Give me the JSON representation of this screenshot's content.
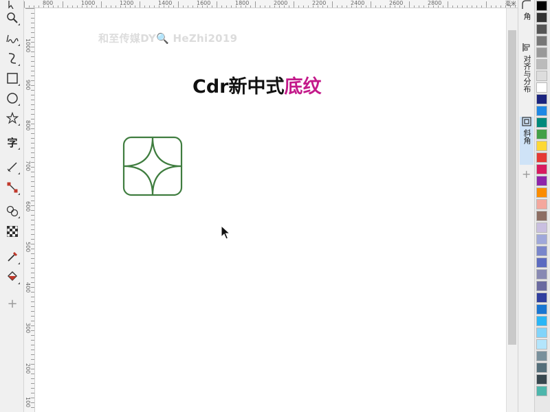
{
  "ruler_top": {
    "labels": [
      "800",
      "1000",
      "1200",
      "1400",
      "1600",
      "1800",
      "2000",
      "2200",
      "2400",
      "2600",
      "2800"
    ],
    "unit": "毫米"
  },
  "ruler_left": {
    "labels": [
      "1000",
      "900",
      "800",
      "700",
      "600",
      "500",
      "400",
      "300",
      "200",
      "100"
    ]
  },
  "toolbox": {
    "tools": [
      "pick-tool",
      "zoom-tool",
      "freehand-tool",
      "smart-drawing-tool",
      "rectangle-tool",
      "ellipse-tool",
      "polygon-tool",
      "text-tool",
      "dimension-tool",
      "connector-tool",
      "blend-tool",
      "transparency-tool",
      "eyedropper-tool",
      "interactive-fill-tool"
    ],
    "text_tool_glyph": "字",
    "add_glyph": "+"
  },
  "canvas": {
    "watermark": "和至传媒DY🔍 HeZhi2019",
    "title_prefix": "Cdr新中式",
    "title_accent": "底纹",
    "colors": {
      "title": "#111111",
      "accent": "#c31a8a",
      "motif_stroke": "#3f7d3f"
    }
  },
  "docker": {
    "tabs": [
      {
        "label": "角",
        "icon": "corner-icon"
      },
      {
        "label": "对齐与分布",
        "icon": "align-icon"
      },
      {
        "label": "斜角",
        "icon": "bevel-icon"
      }
    ],
    "add_glyph": "+"
  },
  "palette": {
    "colors": [
      "#000000",
      "#333333",
      "#555555",
      "#777777",
      "#999999",
      "#bbbbbb",
      "#dddddd",
      "#ffffff",
      "#1a237e",
      "#1e88e5",
      "#00897b",
      "#43a047",
      "#fdd835",
      "#e53935",
      "#d81b60",
      "#8e24aa",
      "#fb8c00",
      "#f4a79d",
      "#8d6e63",
      "#c9bfe0",
      "#9fa8da",
      "#7986cb",
      "#5c6bc0",
      "#8889b3",
      "#6a6aa0",
      "#303f9f",
      "#1976d2",
      "#29b6f6",
      "#81d4fa",
      "#b3e5fc",
      "#78909c",
      "#546e7a",
      "#37474f",
      "#4db6ac"
    ]
  }
}
